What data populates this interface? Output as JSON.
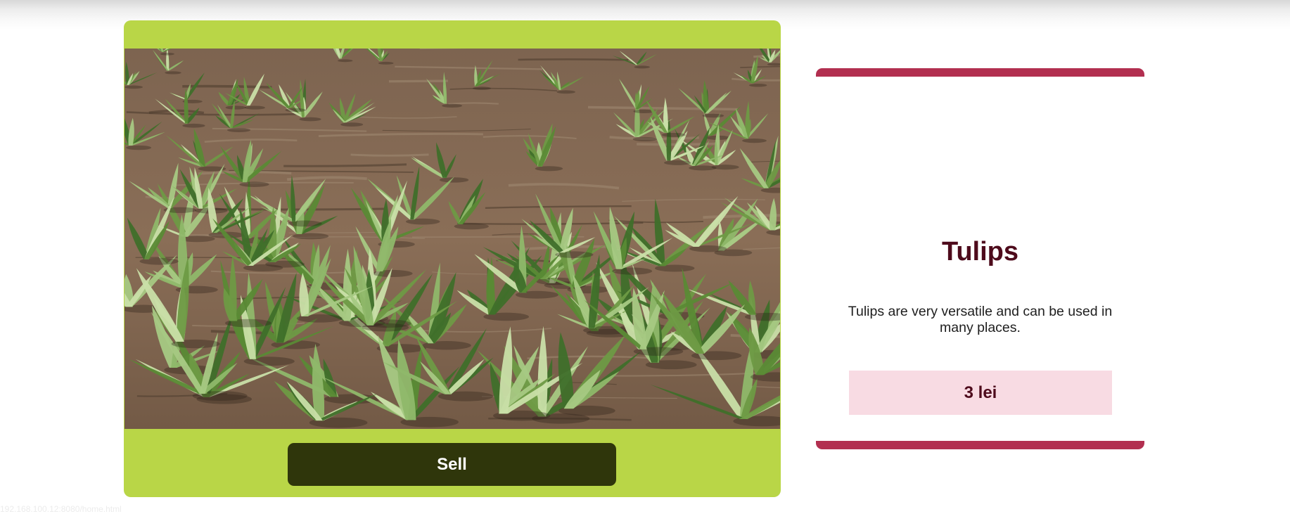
{
  "product": {
    "image_alt": "Rows of young tulip plants growing in a brown soil field",
    "sell_label": "Sell"
  },
  "info": {
    "title": "Tulips",
    "description": "Tulips are very versatile and can be used in many places.",
    "price": "3 lei"
  },
  "status_bar": {
    "url": "192.168.100.12:8080/home.html"
  },
  "colors": {
    "card_green": "#b9d647",
    "button_dark": "#2f360b",
    "accent_crimson": "#b22f50",
    "title_maroon": "#4e0b1c",
    "price_pink": "#f8dbe3"
  }
}
